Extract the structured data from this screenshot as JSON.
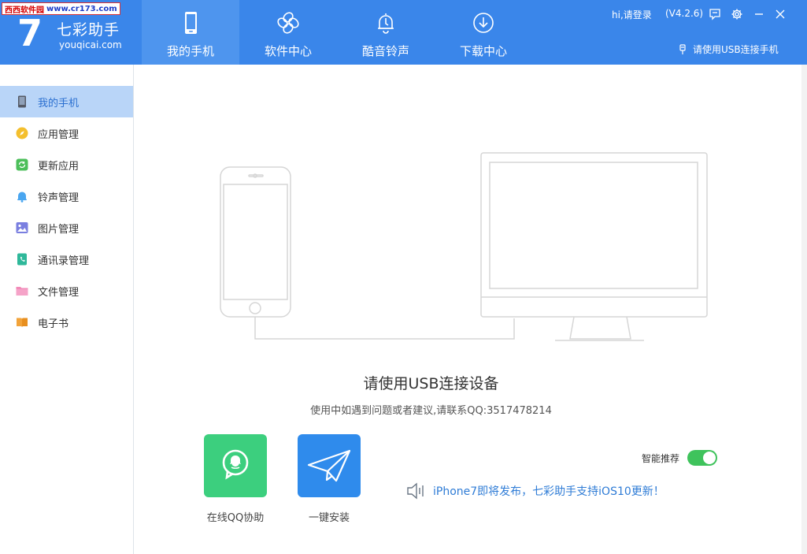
{
  "watermark": {
    "site_cn": "西西软件园",
    "site_url": "www.cr173.com"
  },
  "app": {
    "logo_number": "7",
    "name": "七彩助手",
    "url": "youqicai.com",
    "login": "hi,请登录",
    "version": "(V4.2.6)",
    "usb_hint": "请使用USB连接手机"
  },
  "nav": {
    "tabs": [
      {
        "label": "我的手机",
        "icon": "phone-icon",
        "active": true
      },
      {
        "label": "软件中心",
        "icon": "clover-icon",
        "active": false
      },
      {
        "label": "酷音铃声",
        "icon": "bell-icon",
        "active": false
      },
      {
        "label": "下载中心",
        "icon": "download-icon",
        "active": false
      }
    ]
  },
  "sidebar": {
    "items": [
      {
        "label": "我的手机",
        "icon": "phone-icon",
        "active": true
      },
      {
        "label": "应用管理",
        "icon": "compass-icon"
      },
      {
        "label": "更新应用",
        "icon": "refresh-icon"
      },
      {
        "label": "铃声管理",
        "icon": "bell-icon"
      },
      {
        "label": "图片管理",
        "icon": "picture-icon"
      },
      {
        "label": "通讯录管理",
        "icon": "contacts-icon"
      },
      {
        "label": "文件管理",
        "icon": "folder-icon"
      },
      {
        "label": "电子书",
        "icon": "book-icon"
      }
    ]
  },
  "main": {
    "headline": "请使用USB连接设备",
    "subline": "使用中如遇到问题或者建议,请联系QQ:3517478214",
    "actions": [
      {
        "label": "在线QQ协助",
        "icon": "qq-icon",
        "color": "#3ccf7e"
      },
      {
        "label": "一键安装",
        "icon": "paper-plane-icon",
        "color": "#2f8bec"
      }
    ],
    "recommend_label": "智能推荐",
    "recommend_on": true,
    "notice": "iPhone7即将发布，七彩助手支持iOS10更新！"
  },
  "colors": {
    "header": "#3a86ea",
    "active_tab": "#4e95ee",
    "sidebar_active": "#b9d5f8",
    "toggle_on": "#3fc35c",
    "notice_text": "#2f7cd6"
  }
}
